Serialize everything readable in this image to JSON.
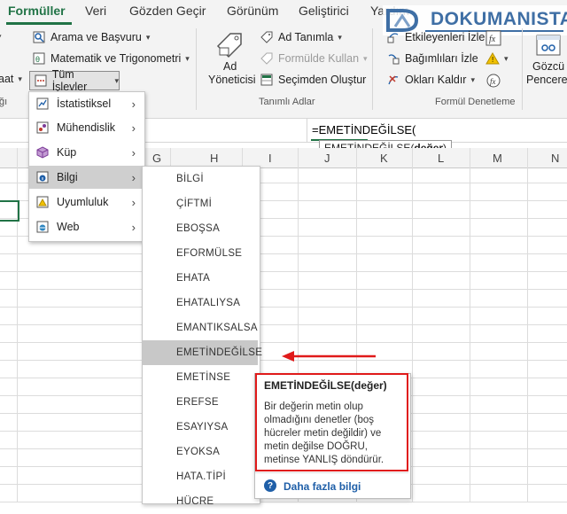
{
  "ribbon": {
    "tabs": [
      "Formüller",
      "Veri",
      "Gözden Geçir",
      "Görünüm",
      "Geliştirici",
      "Yardım"
    ],
    "left_cut_labels": [
      "aat",
      "ığı"
    ],
    "arama": "Arama ve Başvuru",
    "matematik": "Matematik ve Trigonometri",
    "tum_islevler": "Tüm İşlevler",
    "ad_tanimla": "Ad Tanımla",
    "formulde_kullan": "Formülde Kullan",
    "secimden_olustur": "Seçimden Oluştur",
    "ad_yoneticisi_1": "Ad",
    "ad_yoneticisi_2": "Yöneticisi",
    "tanimli_adlar": "Tanımlı Adlar",
    "etkilenenleri_izle": "Etkileyenleri İzle",
    "bagimlilari_izle": "Bağımlıları İzle",
    "oklari_kaldir": "Okları Kaldır",
    "formul_denetleme": "Formül Denetleme",
    "gozcu_1": "Gözcü",
    "gozcu_2": "Penceres"
  },
  "watermark": {
    "text": "DOKUMANISTAN"
  },
  "formula_bar": {
    "text": "=EMETİNDEĞİLSE(",
    "tooltip_fn": "EMETİNDEĞİLSE(",
    "tooltip_arg": "değer",
    "tooltip_close": ")"
  },
  "columns": [
    "G",
    "H",
    "I",
    "J",
    "K",
    "L",
    "M",
    "N"
  ],
  "menu": [
    {
      "label": "İstatistiksel",
      "icon": "chart-line-icon"
    },
    {
      "label": "Mühendislik",
      "icon": "engineering-icon"
    },
    {
      "label": "Küp",
      "icon": "cube-icon"
    },
    {
      "label": "Bilgi",
      "icon": "info-icon"
    },
    {
      "label": "Uyumluluk",
      "icon": "warning-icon"
    },
    {
      "label": "Web",
      "icon": "globe-icon"
    }
  ],
  "submenu": [
    "BİLGİ",
    "ÇİFTMİ",
    "EBOŞSA",
    "EFORMÜLSE",
    "EHATA",
    "EHATALIYSA",
    "EMANTIKSALSA",
    "EMETİNDEĞİLSE",
    "EMETİNSE",
    "EREFSE",
    "ESAYIYSA",
    "EYOKSA",
    "HATA.TİPİ",
    "HÜCRE"
  ],
  "description": {
    "title": "EMETİNDEĞİLSE(değer)",
    "body": "Bir değerin metin olup olmadığını denetler (boş hücreler metin değildir) ve metin değilse DOĞRU, metinse YANLIŞ döndürür.",
    "link": "Daha fazla bilgi"
  },
  "colors": {
    "accent": "#217346",
    "annotation": "#e01a1a",
    "link": "#1f5fa8"
  }
}
